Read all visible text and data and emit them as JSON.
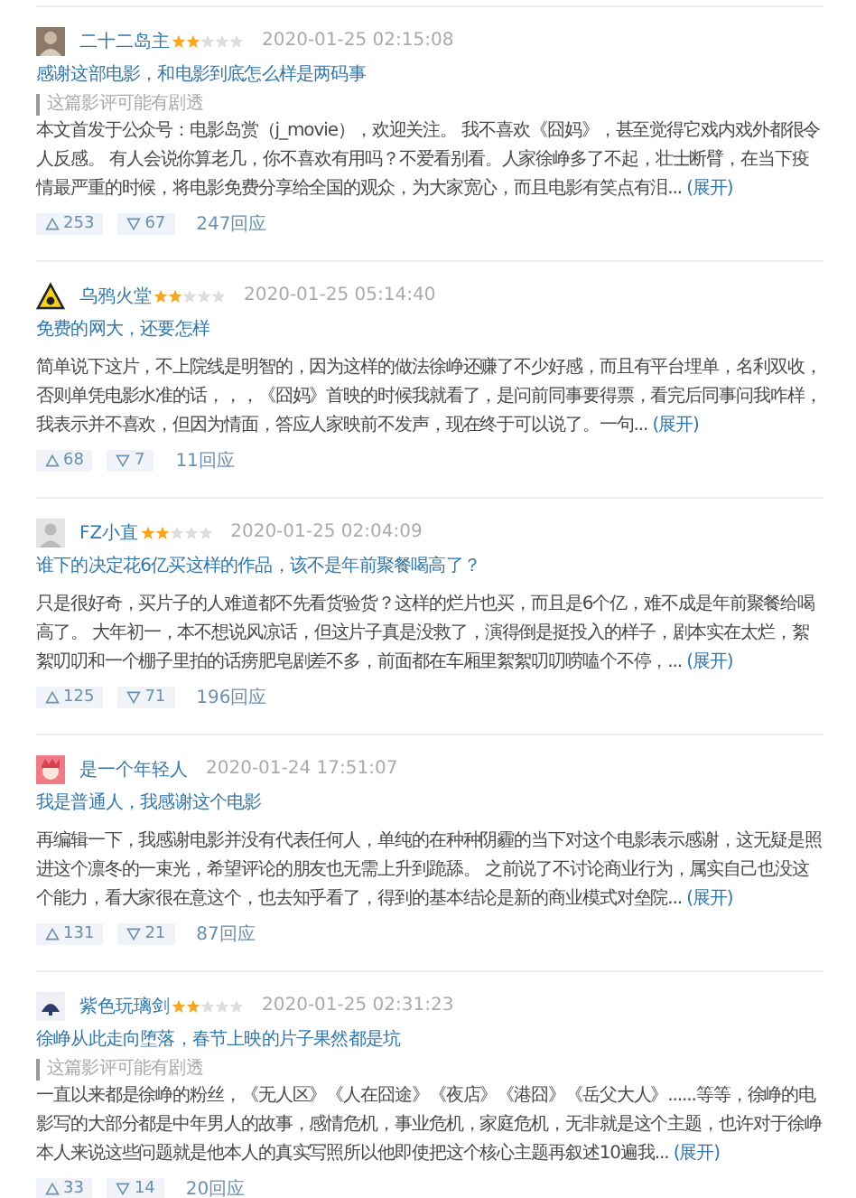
{
  "reviews": [
    {
      "user": "二十二岛主",
      "stars": 2,
      "time": "2020-01-25 02:15:08",
      "title": "感谢这部电影，和电影到底怎么样是两码事",
      "spoiler": "这篇影评可能有剧透",
      "body": "本文首发于公众号：电影岛赏（j_movie），欢迎关注。 我不喜欢《囧妈》，甚至觉得它戏内戏外都很令人反感。 有人会说你算老几，你不喜欢有用吗？不爱看别看。人家徐峥多了不起，壮士断臂，在当下疫情最严重的时候，将电影免费分享给全国的观众，为大家宽心，而且电影有笑点有泪...",
      "expand": "(展开)",
      "up": "253",
      "down": "67",
      "replies": "247回应"
    },
    {
      "user": "乌鸦火堂",
      "stars": 2,
      "time": "2020-01-25 05:14:40",
      "title": "免费的网大，还要怎样",
      "body": "简单说下这片，不上院线是明智的，因为这样的做法徐峥还赚了不少好感，而且有平台埋单，名利双收，否则单凭电影水准的话，，，《囧妈》首映的时候我就看了，是问前同事要得票，看完后同事问我咋样，我表示并不喜欢，但因为情面，答应人家映前不发声，现在终于可以说了。一句...",
      "expand": "(展开)",
      "up": "68",
      "down": "7",
      "replies": "11回应"
    },
    {
      "user": "FZ小直",
      "stars": 2,
      "time": "2020-01-25 02:04:09",
      "title": "谁下的决定花6亿买这样的作品，该不是年前聚餐喝高了？",
      "body": "只是很好奇，买片子的人难道都不先看货验货？这样的烂片也买，而且是6个亿，难不成是年前聚餐给喝高了。 大年初一，本不想说风凉话，但这片子真是没救了，演得倒是挺投入的样子，剧本实在太烂，絮絮叨叨和一个棚子里拍的话痨肥皂剧差不多，前面都在车厢里絮絮叨叨唠嗑个不停，...",
      "expand": "(展开)",
      "up": "125",
      "down": "71",
      "replies": "196回应"
    },
    {
      "user": "是一个年轻人",
      "time": "2020-01-24 17:51:07",
      "title": "我是普通人，我感谢这个电影",
      "body": "再编辑一下，我感谢电影并没有代表任何人，单纯的在种种阴霾的当下对这个电影表示感谢，这无疑是照进这个凛冬的一束光，希望评论的朋友也无需上升到跪舔。 之前说了不讨论商业行为，属实自己也没这个能力，看大家很在意这个，也去知乎看了，得到的基本结论是新的商业模式对垒院...",
      "expand": "(展开)",
      "up": "131",
      "down": "21",
      "replies": "87回应"
    },
    {
      "user": "紫色玩璃剑",
      "stars": 2,
      "time": "2020-01-25 02:31:23",
      "title": "徐峥从此走向堕落，春节上映的片子果然都是坑",
      "spoiler": "这篇影评可能有剧透",
      "body": "一直以来都是徐峥的粉丝，《无人区》《人在囧途》《夜店》《港囧》《岳父大人》......等等，徐峥的电影写的大部分都是中年男人的故事，感情危机，事业危机，家庭危机，无非就是这个主题，也许对于徐峥本人来说这些问题就是他本人的真实写照所以他即使把这个核心主题再叙述10遍我...",
      "expand": "(展开)",
      "up": "33",
      "down": "14",
      "replies": "20回应"
    }
  ]
}
